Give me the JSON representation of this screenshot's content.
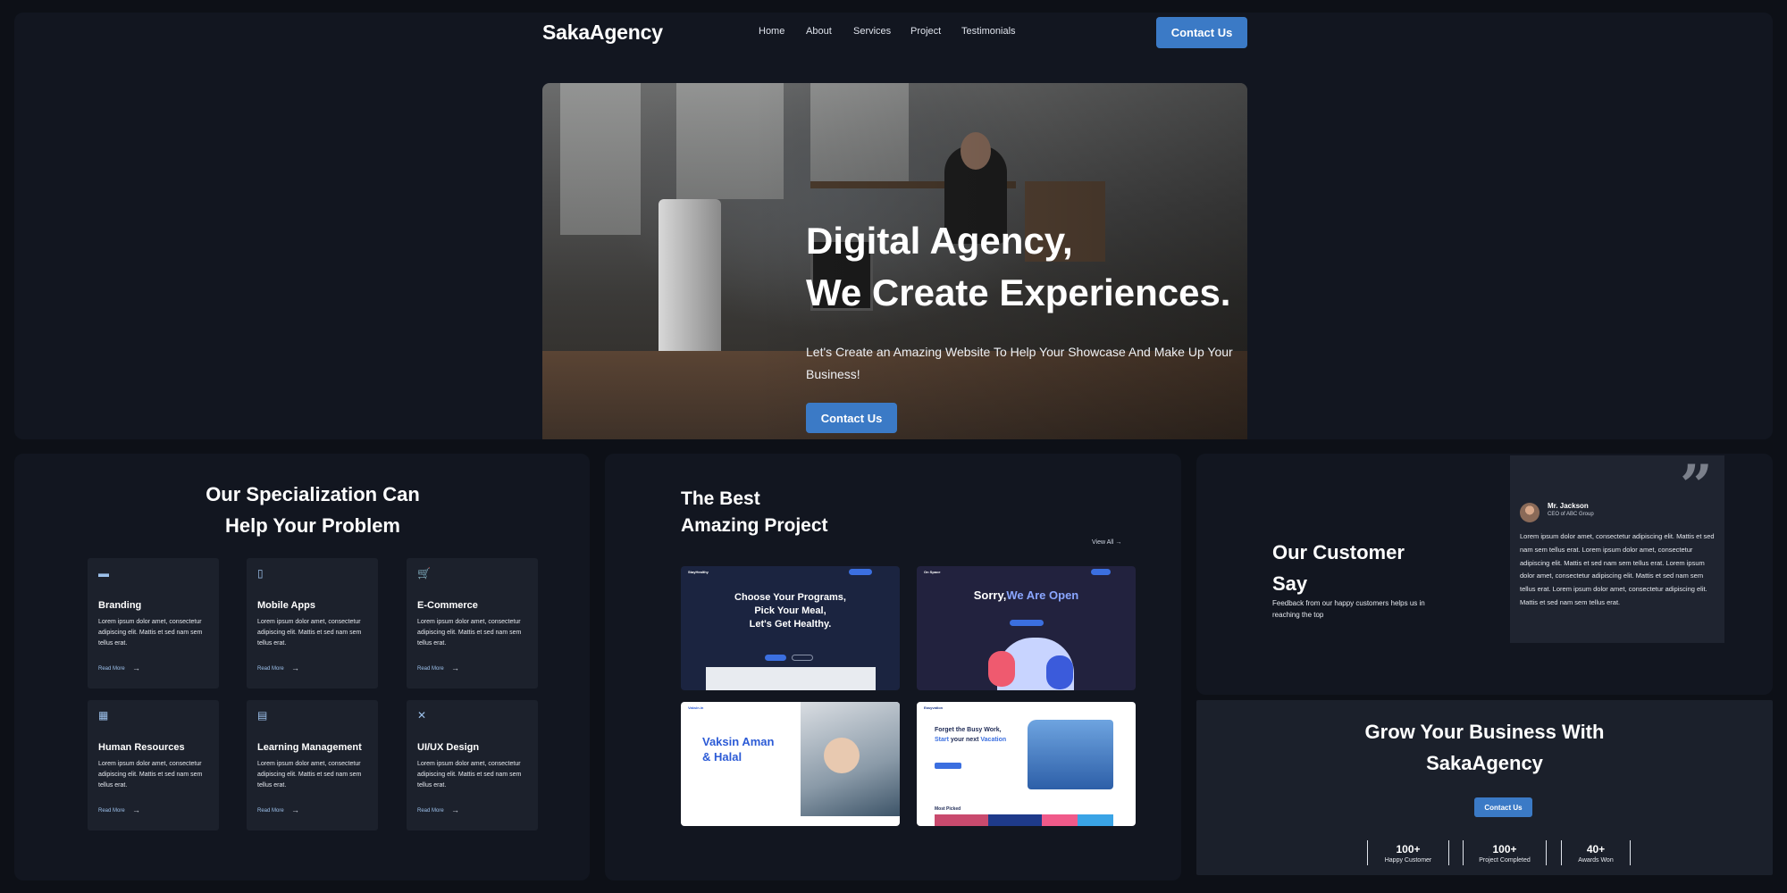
{
  "header": {
    "logo": "SakaAgency",
    "nav": [
      "Home",
      "About",
      "Services",
      "Project",
      "Testimonials"
    ],
    "contact_label": "Contact Us"
  },
  "hero": {
    "title_line1": "Digital Agency,",
    "title_line2": "We Create Experiences.",
    "subtitle": "Let's Create an Amazing Website To Help Your Showcase And Make Up Your Business!",
    "contact_label": "Contact Us"
  },
  "specialization": {
    "title_line1": "Our Specialization Can",
    "title_line2": "Help Your Problem",
    "services": [
      {
        "icon": "branding-icon",
        "title": "Branding",
        "text": "Lorem ipsum dolor amet, consectetur adipiscing elit. Mattis et sed nam sem tellus erat.",
        "link": "Read More"
      },
      {
        "icon": "mobile-icon",
        "title": "Mobile Apps",
        "text": "Lorem ipsum dolor amet, consectetur adipiscing elit. Mattis et sed nam sem tellus erat.",
        "link": "Read More"
      },
      {
        "icon": "cart-icon",
        "title": "E-Commerce",
        "text": "Lorem ipsum dolor amet, consectetur adipiscing elit. Mattis et sed nam sem tellus erat.",
        "link": "Read More"
      },
      {
        "icon": "people-icon",
        "title": "Human Resources",
        "text": "Lorem ipsum dolor amet, consectetur adipiscing elit. Mattis et sed nam sem tellus erat.",
        "link": "Read More"
      },
      {
        "icon": "learning-icon",
        "title": "Learning Management",
        "text": "Lorem ipsum dolor amet, consectetur adipiscing elit. Mattis et sed nam sem tellus erat.",
        "link": "Read More"
      },
      {
        "icon": "tools-icon",
        "title": "UI/UX Design",
        "text": "Lorem ipsum dolor amet, consectetur adipiscing elit. Mattis et sed nam sem tellus erat.",
        "link": "Read More"
      }
    ]
  },
  "projects": {
    "title_line1": "The Best",
    "title_line2": "Amazing Project",
    "view_all": "View All",
    "items": [
      {
        "brand": "StayHealthy",
        "headline1": "Choose Your Programs,",
        "headline2": "Pick Your Meal,",
        "headline3": "Let's Get Healthy."
      },
      {
        "brand": "On Space",
        "headline_white": "Sorry,",
        "headline_accent": "We Are Open"
      },
      {
        "brand": "Vaksin.in",
        "headline1": "Vaksin Aman",
        "headline2": "& Halal"
      },
      {
        "brand": "Easyvation",
        "headline1": "Forget the Busy Work,",
        "headline2a": "Start",
        "headline2b": "your next",
        "headline2c": "Vacation",
        "section": "Most Picked"
      }
    ]
  },
  "customers": {
    "title_line1": "Our Customer",
    "title_line2": "Say",
    "subtitle": "Feedback from our happy customers helps us in reaching the top",
    "testimonial": {
      "name": "Mr. Jackson",
      "role": "CEO of ABC Group",
      "body": "Lorem ipsum dolor amet, consectetur adipiscing elit. Mattis et sed nam sem tellus erat. Lorem ipsum dolor amet, consectetur adipiscing elit. Mattis et sed nam sem tellus erat. Lorem ipsum dolor amet, consectetur adipiscing elit. Mattis et sed nam sem tellus erat. Lorem ipsum dolor amet, consectetur adipiscing elit. Mattis et sed nam sem tellus erat."
    }
  },
  "grow": {
    "title_line1": "Grow Your Business With",
    "title_line2": "SakaAgency",
    "contact_label": "Contact Us",
    "stats": [
      {
        "value": "100+",
        "label": "Happy Customer"
      },
      {
        "value": "100+",
        "label": "Project Completed"
      },
      {
        "value": "40+",
        "label": "Awards Won"
      }
    ]
  },
  "colors": {
    "accent": "#3b7ac6",
    "background": "#0d1017",
    "panel": "#121620",
    "card": "#1c212c"
  }
}
